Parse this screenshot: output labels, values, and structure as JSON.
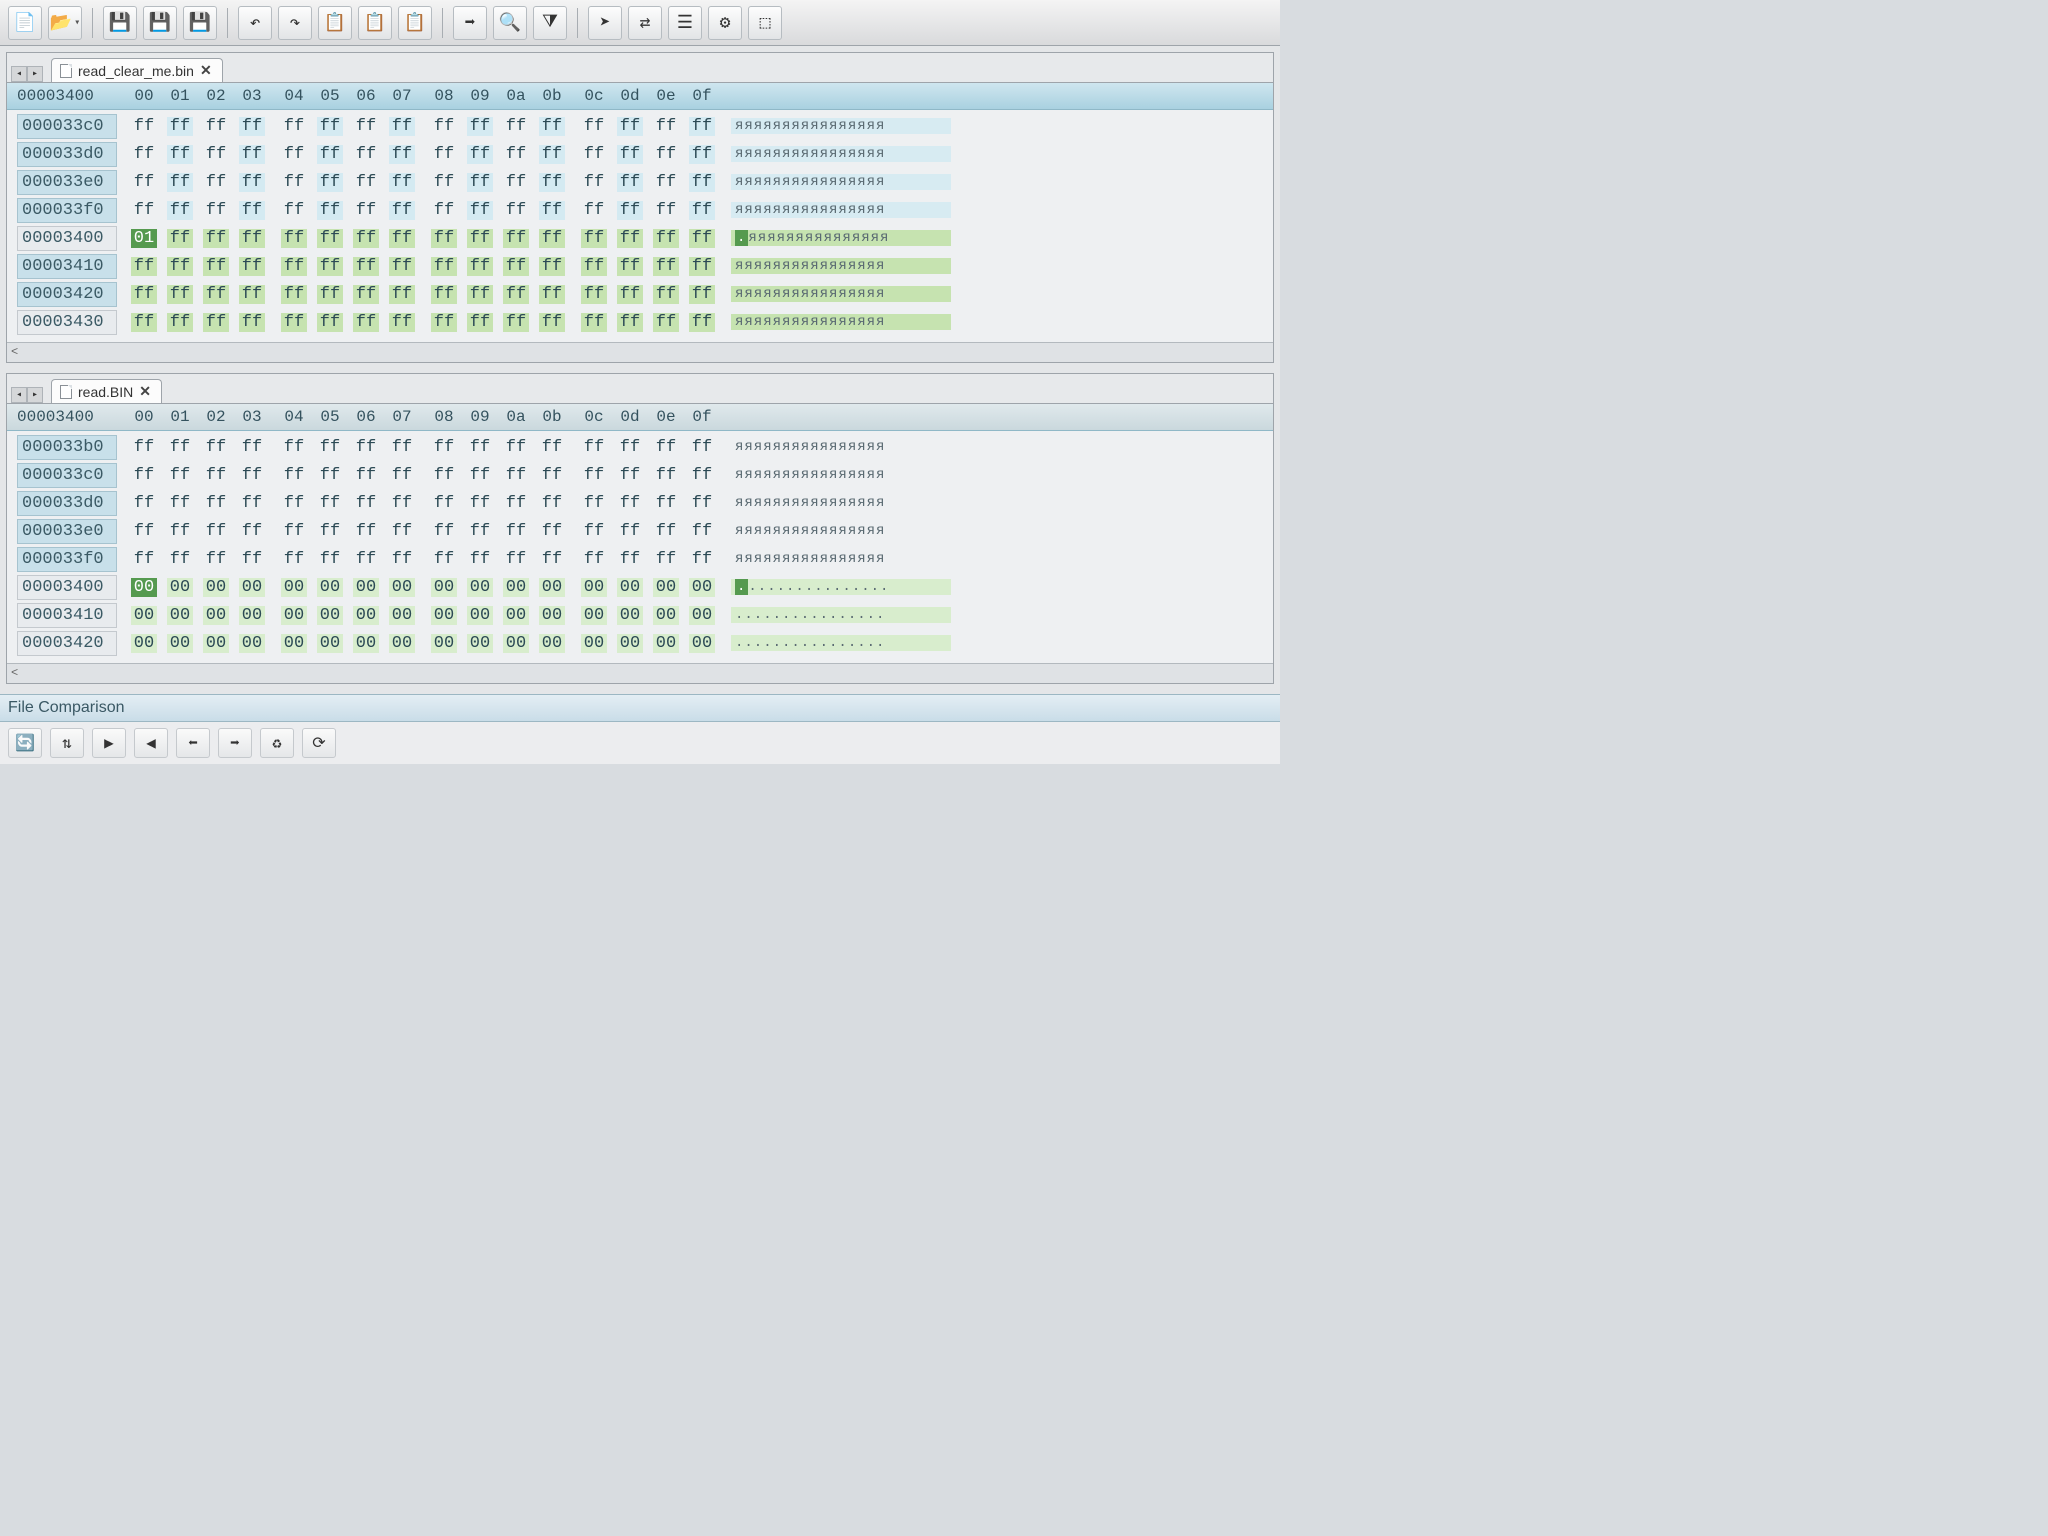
{
  "toolbar": {
    "icons": [
      "new",
      "open",
      "save",
      "save-as",
      "save-all",
      "undo",
      "redo",
      "paste",
      "copy",
      "cut",
      "export",
      "find",
      "filter",
      "goto",
      "compare",
      "template",
      "tool1",
      "tool2"
    ]
  },
  "pane_top": {
    "filename": "read_clear_me.bin",
    "header_offset": "00003400",
    "cols": [
      "00",
      "01",
      "02",
      "03",
      "04",
      "05",
      "06",
      "07",
      "08",
      "09",
      "0a",
      "0b",
      "0c",
      "0d",
      "0e",
      "0f"
    ],
    "rows": [
      {
        "off": "000033c0",
        "b": [
          "ff",
          "ff",
          "ff",
          "ff",
          "ff",
          "ff",
          "ff",
          "ff",
          "ff",
          "ff",
          "ff",
          "ff",
          "ff",
          "ff",
          "ff",
          "ff"
        ],
        "ascii": "яяяяяяяяяяяяяяяя",
        "cls": "hl-stripe"
      },
      {
        "off": "000033d0",
        "b": [
          "ff",
          "ff",
          "ff",
          "ff",
          "ff",
          "ff",
          "ff",
          "ff",
          "ff",
          "ff",
          "ff",
          "ff",
          "ff",
          "ff",
          "ff",
          "ff"
        ],
        "ascii": "яяяяяяяяяяяяяяяя",
        "cls": "hl-stripe"
      },
      {
        "off": "000033e0",
        "b": [
          "ff",
          "ff",
          "ff",
          "ff",
          "ff",
          "ff",
          "ff",
          "ff",
          "ff",
          "ff",
          "ff",
          "ff",
          "ff",
          "ff",
          "ff",
          "ff"
        ],
        "ascii": "яяяяяяяяяяяяяяяя",
        "cls": "hl-stripe"
      },
      {
        "off": "000033f0",
        "b": [
          "ff",
          "ff",
          "ff",
          "ff",
          "ff",
          "ff",
          "ff",
          "ff",
          "ff",
          "ff",
          "ff",
          "ff",
          "ff",
          "ff",
          "ff",
          "ff"
        ],
        "ascii": "яяяяяяяяяяяяяяяя",
        "cls": "hl-stripe"
      },
      {
        "off": "00003400",
        "b": [
          "01",
          "ff",
          "ff",
          "ff",
          "ff",
          "ff",
          "ff",
          "ff",
          "ff",
          "ff",
          "ff",
          "ff",
          "ff",
          "ff",
          "ff",
          "ff"
        ],
        "ascii": ".яяяяяяяяяяяяяяя",
        "cls": "hl-green",
        "plain": true,
        "cursor": true
      },
      {
        "off": "00003410",
        "b": [
          "ff",
          "ff",
          "ff",
          "ff",
          "ff",
          "ff",
          "ff",
          "ff",
          "ff",
          "ff",
          "ff",
          "ff",
          "ff",
          "ff",
          "ff",
          "ff"
        ],
        "ascii": "яяяяяяяяяяяяяяяя",
        "cls": "hl-green"
      },
      {
        "off": "00003420",
        "b": [
          "ff",
          "ff",
          "ff",
          "ff",
          "ff",
          "ff",
          "ff",
          "ff",
          "ff",
          "ff",
          "ff",
          "ff",
          "ff",
          "ff",
          "ff",
          "ff"
        ],
        "ascii": "яяяяяяяяяяяяяяяя",
        "cls": "hl-green"
      },
      {
        "off": "00003430",
        "b": [
          "ff",
          "ff",
          "ff",
          "ff",
          "ff",
          "ff",
          "ff",
          "ff",
          "ff",
          "ff",
          "ff",
          "ff",
          "ff",
          "ff",
          "ff",
          "ff"
        ],
        "ascii": "яяяяяяяяяяяяяяяя",
        "cls": "hl-green",
        "plain": true
      }
    ]
  },
  "pane_bottom": {
    "filename": "read.BIN",
    "header_offset": "00003400",
    "cols": [
      "00",
      "01",
      "02",
      "03",
      "04",
      "05",
      "06",
      "07",
      "08",
      "09",
      "0a",
      "0b",
      "0c",
      "0d",
      "0e",
      "0f"
    ],
    "rows": [
      {
        "off": "000033b0",
        "b": [
          "ff",
          "ff",
          "ff",
          "ff",
          "ff",
          "ff",
          "ff",
          "ff",
          "ff",
          "ff",
          "ff",
          "ff",
          "ff",
          "ff",
          "ff",
          "ff"
        ],
        "ascii": "яяяяяяяяяяяяяяяя",
        "cls": ""
      },
      {
        "off": "000033c0",
        "b": [
          "ff",
          "ff",
          "ff",
          "ff",
          "ff",
          "ff",
          "ff",
          "ff",
          "ff",
          "ff",
          "ff",
          "ff",
          "ff",
          "ff",
          "ff",
          "ff"
        ],
        "ascii": "яяяяяяяяяяяяяяяя",
        "cls": ""
      },
      {
        "off": "000033d0",
        "b": [
          "ff",
          "ff",
          "ff",
          "ff",
          "ff",
          "ff",
          "ff",
          "ff",
          "ff",
          "ff",
          "ff",
          "ff",
          "ff",
          "ff",
          "ff",
          "ff"
        ],
        "ascii": "яяяяяяяяяяяяяяяя",
        "cls": ""
      },
      {
        "off": "000033e0",
        "b": [
          "ff",
          "ff",
          "ff",
          "ff",
          "ff",
          "ff",
          "ff",
          "ff",
          "ff",
          "ff",
          "ff",
          "ff",
          "ff",
          "ff",
          "ff",
          "ff"
        ],
        "ascii": "яяяяяяяяяяяяяяяя",
        "cls": ""
      },
      {
        "off": "000033f0",
        "b": [
          "ff",
          "ff",
          "ff",
          "ff",
          "ff",
          "ff",
          "ff",
          "ff",
          "ff",
          "ff",
          "ff",
          "ff",
          "ff",
          "ff",
          "ff",
          "ff"
        ],
        "ascii": "яяяяяяяяяяяяяяяя",
        "cls": ""
      },
      {
        "off": "00003400",
        "b": [
          "00",
          "00",
          "00",
          "00",
          "00",
          "00",
          "00",
          "00",
          "00",
          "00",
          "00",
          "00",
          "00",
          "00",
          "00",
          "00"
        ],
        "ascii": "................",
        "cls": "hl-lgreen",
        "plain": true,
        "cursor": true
      },
      {
        "off": "00003410",
        "b": [
          "00",
          "00",
          "00",
          "00",
          "00",
          "00",
          "00",
          "00",
          "00",
          "00",
          "00",
          "00",
          "00",
          "00",
          "00",
          "00"
        ],
        "ascii": "................",
        "cls": "hl-lgreen",
        "plain": true
      },
      {
        "off": "00003420",
        "b": [
          "00",
          "00",
          "00",
          "00",
          "00",
          "00",
          "00",
          "00",
          "00",
          "00",
          "00",
          "00",
          "00",
          "00",
          "00",
          "00"
        ],
        "ascii": "................",
        "cls": "hl-lgreen",
        "plain": true
      }
    ]
  },
  "bottom_label": "File Comparison",
  "bottom_tools": [
    "sync",
    "diff",
    "next",
    "prev",
    "copy-left",
    "copy-right",
    "merge",
    "refresh"
  ]
}
